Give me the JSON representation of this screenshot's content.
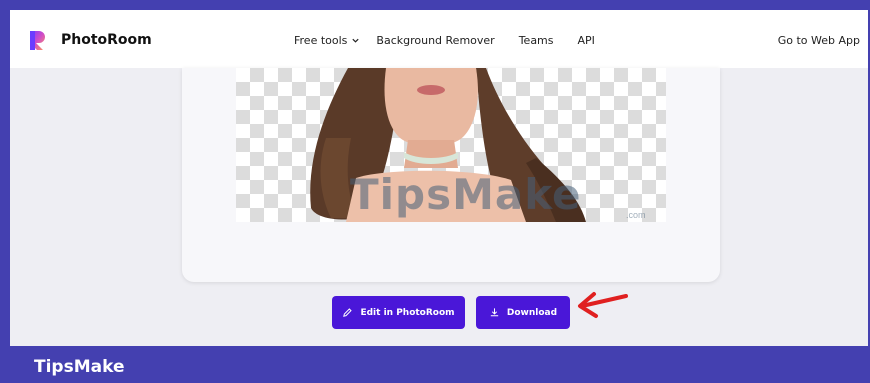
{
  "brand": {
    "name": "PhotoRoom"
  },
  "nav": {
    "free_tools": "Free tools",
    "background_remover": "Background Remover",
    "teams": "Teams",
    "api": "API",
    "web_app": "Go to Web App"
  },
  "preview": {
    "watermark": "TipsMake",
    "watermark_suffix": ".com"
  },
  "actions": {
    "edit_label": "Edit in PhotoRoom",
    "download_label": "Download"
  },
  "footer": {
    "brand": "TipsMake"
  },
  "colors": {
    "accent": "#4a17d8",
    "page_border": "#4440b0",
    "arrow": "#e02020"
  }
}
